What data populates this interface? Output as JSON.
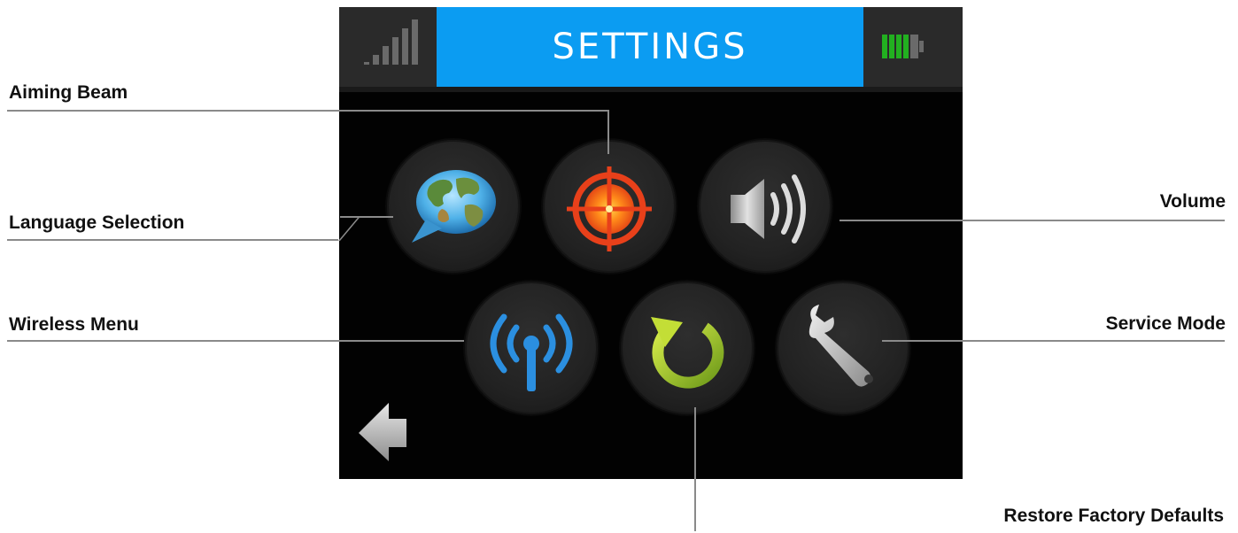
{
  "screen": {
    "title": "SETTINGS",
    "colors": {
      "title_bar": "#0b9cf2",
      "background": "#020202",
      "battery": "#22b020"
    }
  },
  "buttons": [
    {
      "id": "language",
      "icon": "globe-speech-icon"
    },
    {
      "id": "aiming",
      "icon": "crosshair-icon"
    },
    {
      "id": "volume",
      "icon": "speaker-icon"
    },
    {
      "id": "wireless",
      "icon": "antenna-icon"
    },
    {
      "id": "restore",
      "icon": "refresh-icon"
    },
    {
      "id": "service",
      "icon": "wrench-icon"
    }
  ],
  "callouts": {
    "aiming_beam": "Aiming Beam",
    "language_selection": "Language Selection",
    "wireless_menu": "Wireless Menu",
    "volume": "Volume",
    "service_mode": "Service Mode",
    "restore_factory_defaults": "Restore Factory Defaults"
  }
}
